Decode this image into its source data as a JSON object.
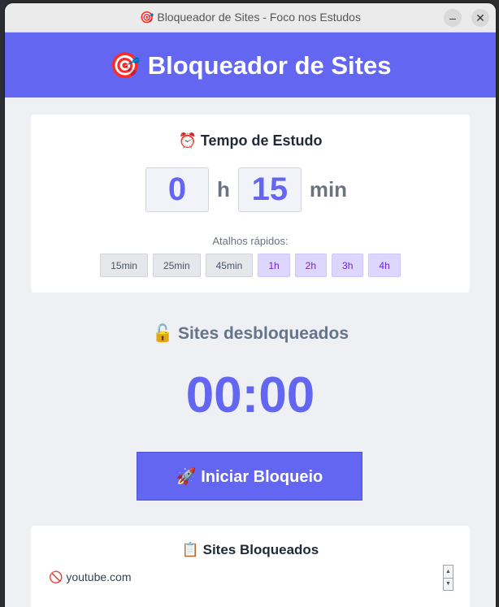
{
  "window": {
    "title": "🎯 Bloqueador de Sites - Foco nos Estudos",
    "minimize_icon": "minimize-icon",
    "close_icon": "close-icon"
  },
  "header": {
    "title": "🎯 Bloqueador de Sites"
  },
  "study_time": {
    "title": "⏰ Tempo de Estudo",
    "hours_value": "0",
    "hours_unit": "h",
    "minutes_value": "15",
    "minutes_unit": "min",
    "shortcuts_label": "Atalhos rápidos:",
    "shortcuts": [
      "15min",
      "25min",
      "45min",
      "1h",
      "2h",
      "3h",
      "4h"
    ]
  },
  "status": {
    "text": "🔓 Sites desbloqueados",
    "timer": "00:00"
  },
  "start_button": {
    "label": "🚀 Iniciar Bloqueio"
  },
  "blocked_sites": {
    "title": "📋 Sites Bloqueados",
    "items": [
      "🚫 youtube.com"
    ]
  },
  "colors": {
    "accent": "#6366f1",
    "shortcut_hour_bg": "#ddd6fe",
    "shortcut_min_bg": "#e5e7eb"
  }
}
